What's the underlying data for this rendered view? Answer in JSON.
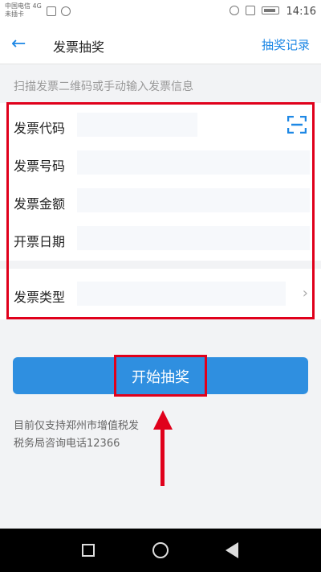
{
  "status_bar": {
    "carrier_line1": "中国电信 4G",
    "carrier_line2": "未插卡",
    "time": "14:16"
  },
  "nav": {
    "title": "发票抽奖",
    "records": "抽奖记录"
  },
  "hint": "扫描发票二维码或手动输入发票信息",
  "form": {
    "fields": [
      {
        "label": "发票代码"
      },
      {
        "label": "发票号码"
      },
      {
        "label": "发票金额"
      },
      {
        "label": "开票日期"
      },
      {
        "label": "发票类型"
      }
    ]
  },
  "button": {
    "label": "开始抽奖"
  },
  "notes": {
    "line1": "目前仅支持郑州市增值税发",
    "line2": "税务局咨询电话12366"
  },
  "colors": {
    "accent": "#1e88e5",
    "button": "#2f8fe0",
    "highlight": "#e0001b"
  },
  "icons": [
    "back-arrow-icon",
    "scan-icon",
    "chevron-right-icon",
    "home-icon",
    "recent-apps-icon",
    "back-icon"
  ]
}
